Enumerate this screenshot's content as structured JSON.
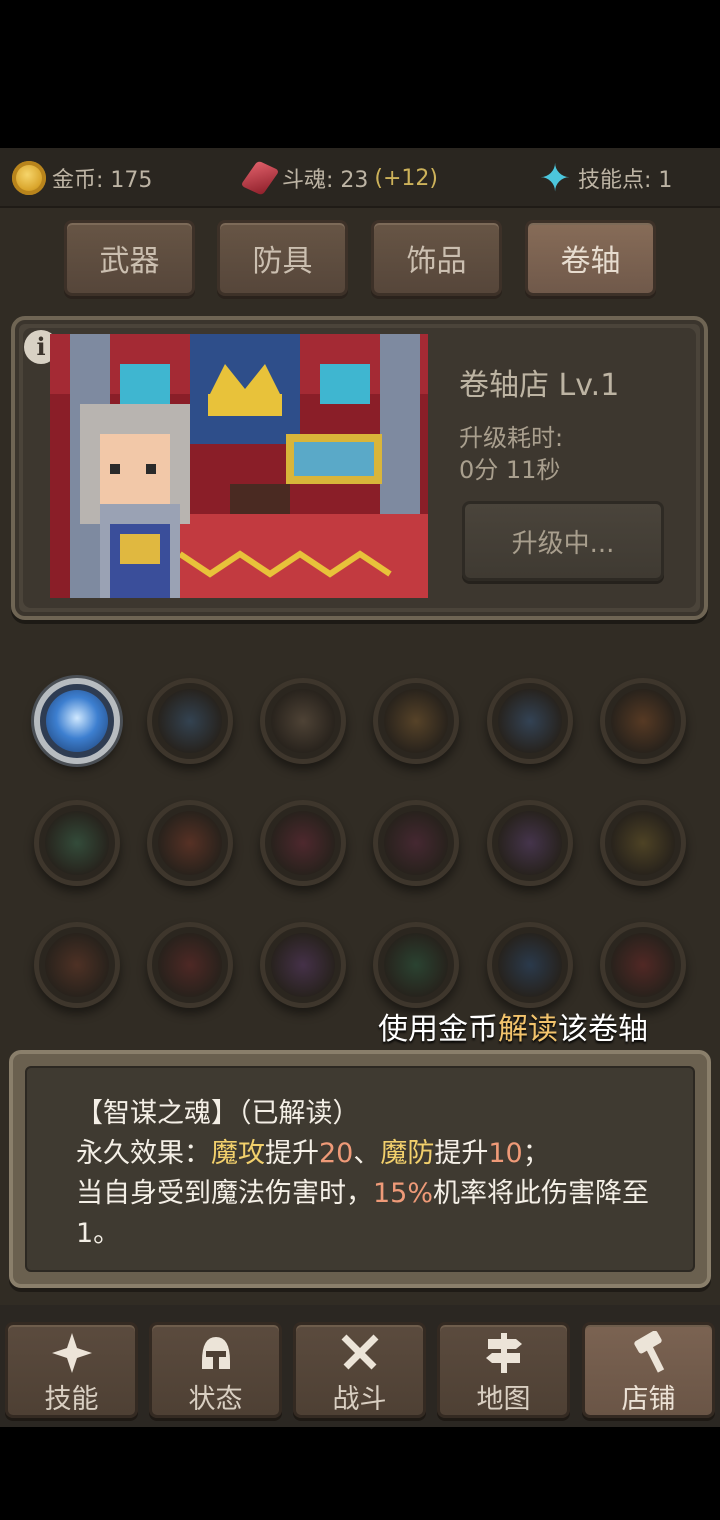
{
  "resources": {
    "gold_label": "金币: 175",
    "soul_label": "斗魂: 23",
    "soul_extra": "(+12)",
    "skill_label": "技能点: 1"
  },
  "tabs": [
    {
      "label": "武器",
      "active": false
    },
    {
      "label": "防具",
      "active": false
    },
    {
      "label": "饰品",
      "active": false
    },
    {
      "label": "卷轴",
      "active": true
    }
  ],
  "shop": {
    "title": "卷轴店 Lv.1",
    "upgrade_time_label": "升级耗时:",
    "upgrade_time": "0分 11秒",
    "upgrade_button": "升级中..."
  },
  "scrolls": [
    {
      "icon": "frost-crystal-icon",
      "unlocked": true,
      "color": "#3d7fd0"
    },
    {
      "icon": "shatter-icon",
      "color": "#3a5a7a"
    },
    {
      "icon": "shield-wheel-icon",
      "color": "#6b5a48"
    },
    {
      "icon": "fire-beast-icon",
      "color": "#7a5a30"
    },
    {
      "icon": "ice-tree-icon",
      "color": "#3a5a80"
    },
    {
      "icon": "flame-burst-icon",
      "color": "#7a4a28"
    },
    {
      "icon": "green-orb-icon",
      "color": "#3a6a50"
    },
    {
      "icon": "lava-crack-icon",
      "color": "#7a3a2a"
    },
    {
      "icon": "dark-dragon-icon",
      "color": "#6a2a3a"
    },
    {
      "icon": "demon-mask-icon",
      "color": "#5a2a40"
    },
    {
      "icon": "purple-shards-icon",
      "color": "#5a4070"
    },
    {
      "icon": "poison-flask-icon",
      "color": "#6a5a2a"
    },
    {
      "icon": "axe-blade-icon",
      "color": "#6a3a2a"
    },
    {
      "icon": "spiral-icon",
      "color": "#6a2a2a"
    },
    {
      "icon": "web-net-icon",
      "color": "#5a3a6a"
    },
    {
      "icon": "heart-icon",
      "color": "#2a5a40"
    },
    {
      "icon": "blue-spider-icon",
      "color": "#2a4a70"
    },
    {
      "icon": "red-rune-icon",
      "color": "#702a2a"
    }
  ],
  "hint": {
    "prefix": "使用金币",
    "highlight": "解读",
    "suffix": "该卷轴"
  },
  "description": {
    "title": "【智谋之魂】（已解读）",
    "line1_prefix": "永久效果：",
    "stat1": "魔攻",
    "mid1": "提升",
    "val1": "20",
    "sep": "、",
    "stat2": "魔防",
    "mid2": "提升",
    "val2": "10",
    "end1": "；",
    "line2_prefix": "当自身受到魔法伤害时，",
    "chance": "15%",
    "line2_suffix": "机率将此伤害降至1。"
  },
  "nav": [
    {
      "label": "技能",
      "icon": "sparkle-icon",
      "active": false
    },
    {
      "label": "状态",
      "icon": "helmet-icon",
      "active": false
    },
    {
      "label": "战斗",
      "icon": "crossed-swords-icon",
      "active": false
    },
    {
      "label": "地图",
      "icon": "signpost-icon",
      "active": false
    },
    {
      "label": "店铺",
      "icon": "hammer-icon",
      "active": true
    }
  ],
  "colors": {
    "background": "#312c24",
    "highlight_yellow": "#f2d06c",
    "highlight_orange": "#ef9a78",
    "hint_highlight": "#f2c36c"
  }
}
